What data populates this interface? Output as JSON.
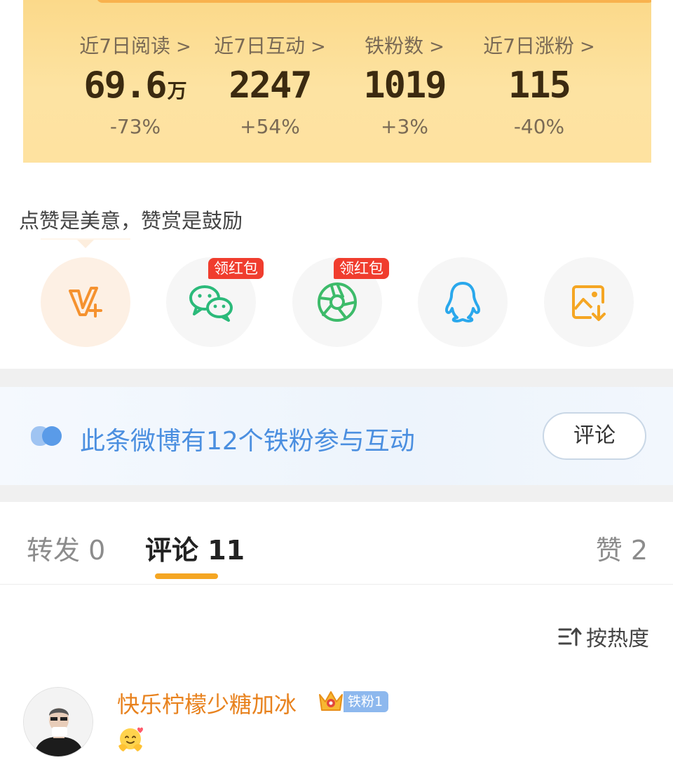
{
  "stats": [
    {
      "label": "近7日阅读",
      "value": "69.6",
      "unit": "万",
      "change": "-73%"
    },
    {
      "label": "近7日互动",
      "value": "2247",
      "unit": "",
      "change": "+54%"
    },
    {
      "label": "铁粉数",
      "value": "1019",
      "unit": "",
      "change": "+3%"
    },
    {
      "label": "近7日涨粉",
      "value": "115",
      "unit": "",
      "change": "-40%"
    }
  ],
  "stat_chevron": ">",
  "share": {
    "hint": "点赞是美意，赞赏是鼓励",
    "buttons": [
      {
        "icon": "v-plus-icon",
        "color": "#f5922f"
      },
      {
        "icon": "wechat-icon",
        "color": "#2bba7a",
        "badge": "领红包"
      },
      {
        "icon": "moments-icon",
        "color": "#3dbb6a",
        "badge": "领红包"
      },
      {
        "icon": "qq-icon",
        "color": "#2aa8ec"
      },
      {
        "icon": "save-image-icon",
        "color": "#f5a623"
      }
    ]
  },
  "fan_banner": {
    "text": "此条微博有12个铁粉参与互动",
    "button": "评论",
    "text_color": "#4b8fe0"
  },
  "tabs": {
    "repost": "转发 0",
    "comments": "评论 11",
    "likes": "赞 2",
    "active": "comments",
    "accent": "#f5a623"
  },
  "sort": {
    "label": "按热度",
    "icon": "sort-icon"
  },
  "comment": {
    "username": "快乐柠檬少糖加冰",
    "badge": "铁粉1",
    "username_color": "#e8821e",
    "content_icon": "hug-emoji-icon"
  }
}
